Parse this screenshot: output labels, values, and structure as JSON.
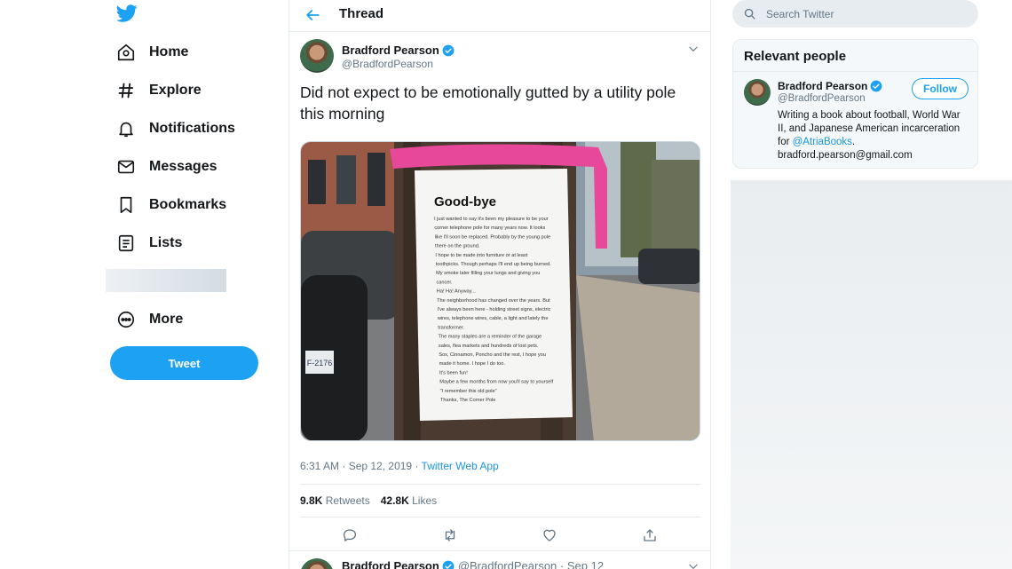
{
  "colors": {
    "accent": "#1da1f2",
    "link": "#1b95e0",
    "text": "#14171a",
    "muted": "#657786"
  },
  "nav": {
    "items": [
      {
        "label": "Home",
        "icon": "home-icon"
      },
      {
        "label": "Explore",
        "icon": "hashtag-icon"
      },
      {
        "label": "Notifications",
        "icon": "bell-icon"
      },
      {
        "label": "Messages",
        "icon": "envelope-icon"
      },
      {
        "label": "Bookmarks",
        "icon": "bookmark-icon"
      },
      {
        "label": "Lists",
        "icon": "list-icon"
      },
      {
        "label": "More",
        "icon": "more-icon"
      }
    ],
    "tweet_button": "Tweet"
  },
  "header": {
    "title": "Thread"
  },
  "tweet": {
    "name": "Bradford Pearson",
    "handle": "@BradfordPearson",
    "text": "Did not expect to be emotionally gutted by a utility pole this morning",
    "time": "6:31 AM · Sep 12, 2019 · ",
    "app": "Twitter Web App",
    "retweets_count": "9.8K",
    "retweets_label": "Retweets",
    "likes_count": "42.8K",
    "likes_label": "Likes",
    "photo": {
      "sign_title": "Good-bye",
      "sign_lines": [
        "I just wanted to say it's been my pleasure to be your",
        "corner telephone pole for many years now. It looks",
        "like I'll soon be replaced. Probably by the young pole",
        "there on the ground.",
        "I hope to be made into furniture or at least",
        "toothpicks. Though perhaps I'll end up being burned.",
        "My smoke later filling your lungs and giving you",
        "cancer.",
        "Ha! Ha! Anyway...",
        "The neighborhood has changed over the years. But",
        "I've always been here - holding street signs, electric",
        "wires, telephone wires, cable, a light and lately the",
        "transformer.",
        "The many staples are a reminder of the garage",
        "sales, flea markets and hundreds of lost pets.",
        "Sox, Cinnamon, Poncho and the rest, I hope you",
        "made it home. I hope I do too.",
        "It's been fun!",
        "Maybe a few months from now you'll say to yourself",
        "\"I remember this old pole\"",
        "Thanks, The Corner Pole"
      ],
      "plate_text": "F-2176"
    }
  },
  "reply": {
    "name": "Bradford Pearson",
    "handle": "@BradfordPearson · Sep 12"
  },
  "search": {
    "placeholder": "Search Twitter"
  },
  "relevant": {
    "title": "Relevant people",
    "name": "Bradford Pearson",
    "handle": "@BradfordPearson",
    "follow_label": "Follow",
    "bio_before": "Writing a book about football, World War II, and Japanese American incarceration for ",
    "bio_link": "@AtriaBooks",
    "bio_after": ".",
    "email": "bradford.pearson@gmail.com"
  }
}
